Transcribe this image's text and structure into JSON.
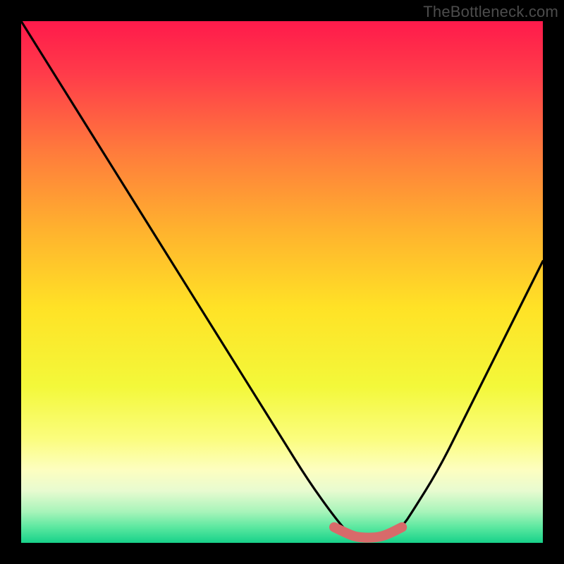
{
  "attribution": "TheBottleneck.com",
  "chart_data": {
    "type": "line",
    "title": "",
    "xlabel": "",
    "ylabel": "",
    "xlim": [
      0,
      100
    ],
    "ylim": [
      0,
      100
    ],
    "series": [
      {
        "name": "bottleneck-curve",
        "x": [
          0,
          5,
          10,
          15,
          20,
          25,
          30,
          35,
          40,
          45,
          50,
          55,
          60,
          63,
          65,
          68,
          70,
          73,
          75,
          80,
          85,
          90,
          95,
          100
        ],
        "y": [
          100,
          92,
          84,
          76,
          68,
          60,
          52,
          44,
          36,
          28,
          20,
          12,
          5,
          1.5,
          1,
          1,
          1.5,
          3,
          6,
          14,
          24,
          34,
          44,
          54
        ]
      },
      {
        "name": "optimal-band",
        "x": [
          60,
          63,
          65,
          68,
          70,
          73
        ],
        "y": [
          3,
          1.5,
          1,
          1,
          1.5,
          3
        ]
      }
    ],
    "gradient_stops": [
      {
        "pos": 0.0,
        "color": "#ff1a4b"
      },
      {
        "pos": 0.1,
        "color": "#ff3b4a"
      },
      {
        "pos": 0.25,
        "color": "#ff7b3c"
      },
      {
        "pos": 0.4,
        "color": "#ffb22e"
      },
      {
        "pos": 0.55,
        "color": "#ffe226"
      },
      {
        "pos": 0.7,
        "color": "#f3f83a"
      },
      {
        "pos": 0.8,
        "color": "#fbfd7d"
      },
      {
        "pos": 0.86,
        "color": "#fdfec0"
      },
      {
        "pos": 0.9,
        "color": "#e8fbd0"
      },
      {
        "pos": 0.94,
        "color": "#a8f4ba"
      },
      {
        "pos": 0.97,
        "color": "#5be8a0"
      },
      {
        "pos": 1.0,
        "color": "#17d18a"
      }
    ],
    "band_color": "#d86a6a",
    "curve_color": "#000000"
  }
}
